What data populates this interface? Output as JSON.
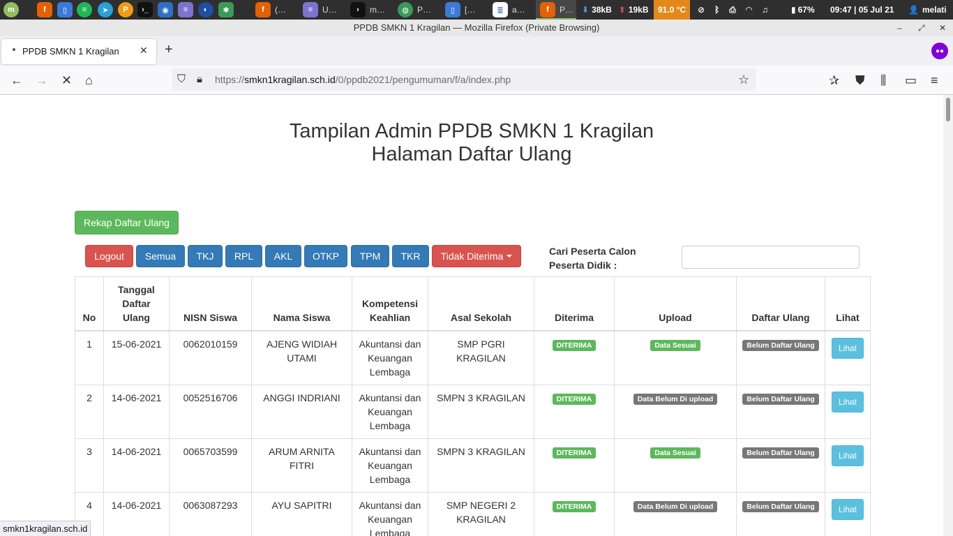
{
  "taskbar": {
    "windows": [
      {
        "label": "(…",
        "icon": "firefox-icon"
      },
      {
        "label": "U…",
        "icon": "text-editor-icon"
      },
      {
        "label": "m…",
        "icon": "terminal-icon"
      },
      {
        "label": "P…",
        "icon": "browser-icon"
      },
      {
        "label": "[…",
        "icon": "document-viewer-icon"
      },
      {
        "label": "a…",
        "icon": "document-icon"
      },
      {
        "label": "P…",
        "icon": "firefox-icon"
      }
    ],
    "net_down": "38kB",
    "net_up": "19kB",
    "temperature": "91.0 °C",
    "battery": "67%",
    "clock": "09:47 | 05 Jul 21",
    "user": "melati"
  },
  "window": {
    "title": "PPDB SMKN 1 Kragilan — Mozilla Firefox (Private Browsing)"
  },
  "browser": {
    "tab_title": "PPDB SMKN 1 Kragilan",
    "url_prefix": "https://",
    "url_host": "smkn1kragilan.sch.id",
    "url_path": "/0/ppdb2021/pengumuman/f/a/index.php",
    "status_url": "smkn1kragilan.sch.id"
  },
  "page": {
    "title_line1": "Tampilan Admin PPDB SMKN 1 Kragilan",
    "title_line2": "Halaman Daftar Ulang",
    "rekap_button": "Rekap Daftar Ulang",
    "nav_buttons": {
      "logout": "Logout",
      "semua": "Semua",
      "tkj": "TKJ",
      "rpl": "RPL",
      "akl": "AKL",
      "otkp": "OTKP",
      "tpm": "TPM",
      "tkr": "TKR",
      "tidak_diterima": "Tidak Diterima"
    },
    "search_label": "Cari Peserta Calon Peserta Didik :",
    "search_value": ""
  },
  "table": {
    "headers": {
      "no": "No",
      "tanggal": "Tanggal Daftar Ulang",
      "nisn": "NISN Siswa",
      "nama": "Nama Siswa",
      "kompetensi": "Kompetensi Keahlian",
      "asal": "Asal Sekolah",
      "diterima": "Diterima",
      "upload": "Upload",
      "daftar_ulang": "Daftar Ulang",
      "lihat": "Lihat"
    },
    "rows": [
      {
        "no": "1",
        "tanggal": "15-06-2021",
        "nisn": "0062010159",
        "nama": "AJENG WIDIAH UTAMI",
        "kompetensi": "Akuntansi dan Keuangan Lembaga",
        "asal": "SMP PGRI KRAGILAN",
        "diterima": "DITERIMA",
        "upload": "Data Sesuai",
        "upload_status": "success",
        "daftar_ulang": "Belum Daftar Ulang",
        "lihat": "Lihat"
      },
      {
        "no": "2",
        "tanggal": "14-06-2021",
        "nisn": "0052516706",
        "nama": "ANGGI INDRIANI",
        "kompetensi": "Akuntansi dan Keuangan Lembaga",
        "asal": "SMPN 3 KRAGILAN",
        "diterima": "DITERIMA",
        "upload": "Data Belum Di upload",
        "upload_status": "default",
        "daftar_ulang": "Belum Daftar Ulang",
        "lihat": "Lihat"
      },
      {
        "no": "3",
        "tanggal": "14-06-2021",
        "nisn": "0065703599",
        "nama": "ARUM ARNITA FITRI",
        "kompetensi": "Akuntansi dan Keuangan Lembaga",
        "asal": "SMPN 3 KRAGILAN",
        "diterima": "DITERIMA",
        "upload": "Data Sesuai",
        "upload_status": "success",
        "daftar_ulang": "Belum Daftar Ulang",
        "lihat": "Lihat"
      },
      {
        "no": "4",
        "tanggal": "14-06-2021",
        "nisn": "0063087293",
        "nama": "AYU SAPITRI",
        "kompetensi": "Akuntansi dan Keuangan Lembaga",
        "asal": "SMP NEGERI 2 KRAGILAN",
        "diterima": "DITERIMA",
        "upload": "Data Belum Di upload",
        "upload_status": "default",
        "daftar_ulang": "Belum Daftar Ulang",
        "lihat": "Lihat"
      }
    ]
  },
  "colors": {
    "success": "#5cb85c",
    "danger": "#d9534f",
    "primary": "#337ab7",
    "info": "#5bc0de",
    "label_default": "#777777",
    "temperature_bg": "#e3891a"
  }
}
